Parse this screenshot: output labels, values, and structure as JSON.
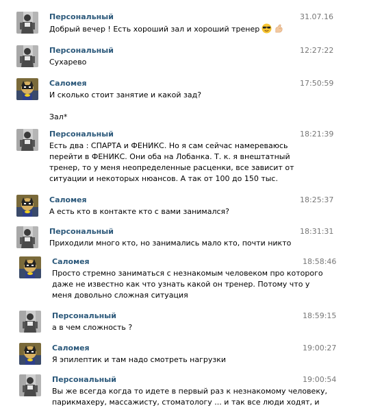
{
  "colors": {
    "author": "#2b587a",
    "time": "#777777",
    "text": "#000000",
    "background": "#ffffff"
  },
  "messages": [
    {
      "author": "Персональный",
      "avatar": "avatar-personal",
      "time": "31.07.16",
      "lines": [
        "Добрый вечер ! Есть хороший зал и хороший тренер"
      ],
      "emoji": [
        "sunglasses-emoji",
        "flexed-biceps-emoji"
      ]
    },
    {
      "author": "Персональный",
      "avatar": "avatar-personal",
      "time": "12:27:22",
      "lines": [
        "Сухарево"
      ]
    },
    {
      "author": "Саломея",
      "avatar": "avatar-salomeya",
      "time": "17:50:59",
      "lines": [
        "И сколько стоит занятие и какой зад?",
        "",
        "Зал*"
      ]
    },
    {
      "author": "Персональный",
      "avatar": "avatar-personal",
      "time": "18:21:39",
      "lines": [
        "Есть два : СПАРТА и ФЕНИКС. Но я сам сейчас намереваюсь",
        "перейти в ФЕНИКС. Они оба на Лобанка. Т. к. я внештатный",
        "тренер, то у меня неопределенные расценки, все зависит от",
        "ситуации и некоторых нюансов. А так от 100 до 150 тыс."
      ]
    },
    {
      "author": "Саломея",
      "avatar": "avatar-salomeya",
      "time": "18:25:37",
      "lines": [
        "А есть кто в контакте кто с вами занимался?"
      ]
    },
    {
      "author": "Персональный",
      "avatar": "avatar-personal",
      "time": "18:31:31",
      "lines": [
        "Приходили много кто, но занимались мало кто, почти никто"
      ]
    },
    {
      "author": "Саломея",
      "avatar": "avatar-salomeya",
      "time": "18:58:46",
      "lines": [
        "Просто стремно заниматься с незнакомым человеком про которого",
        "даже не известно как что узнать какой он тренер. Потому что у",
        "меня довольно сложная ситуация"
      ]
    },
    {
      "author": "Персональный",
      "avatar": "avatar-personal",
      "time": "18:59:15",
      "lines": [
        "а в чем сложность ?"
      ]
    },
    {
      "author": "Саломея",
      "avatar": "avatar-salomeya",
      "time": "19:00:27",
      "lines": [
        "Я эпилептик и там надо смотреть нагрузки"
      ]
    },
    {
      "author": "Персональный",
      "avatar": "avatar-personal",
      "time": "19:00:54",
      "lines": [
        "Вы же всегда когда то идете в первый раз к незнакомому человеку,",
        "парикмахеру, массажисту, стоматологу ... и так все люди ходят, и"
      ]
    }
  ]
}
